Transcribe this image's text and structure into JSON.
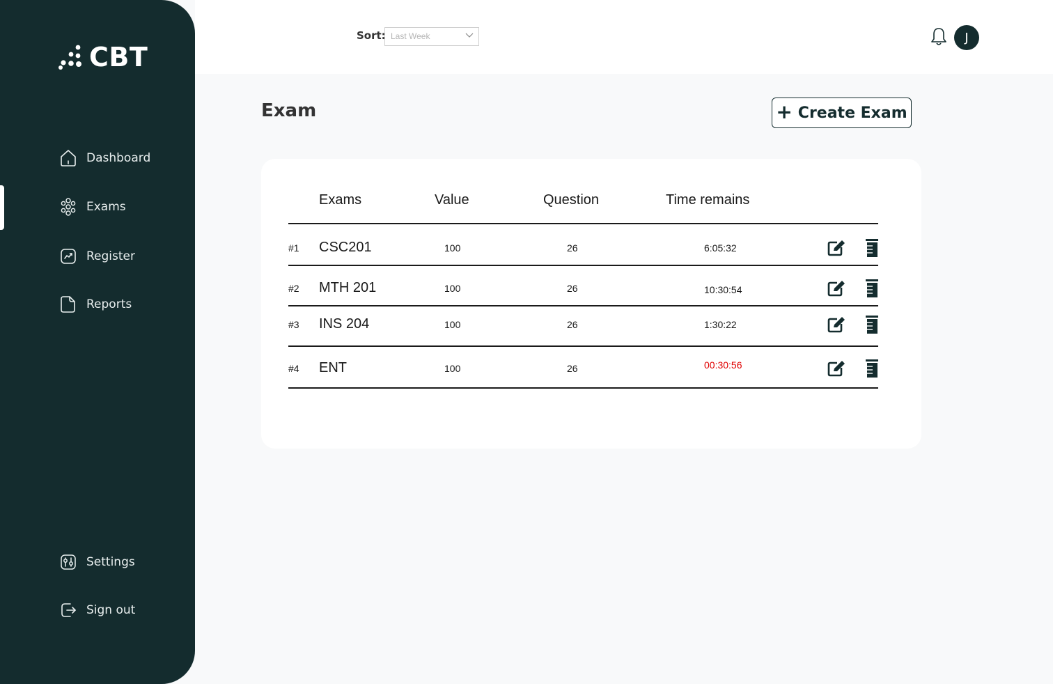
{
  "brand": {
    "name": "CBT",
    "icon": "dots-logo-icon"
  },
  "sidebar": {
    "items": [
      {
        "label": "Dashboard",
        "icon": "home-icon"
      },
      {
        "label": "Exams",
        "icon": "people-icon",
        "active": true
      },
      {
        "label": "Register",
        "icon": "chart-icon"
      },
      {
        "label": "Reports",
        "icon": "document-icon"
      }
    ],
    "bottom_items": [
      {
        "label": "Settings",
        "icon": "settings-icon"
      },
      {
        "label": "Sign out",
        "icon": "sign-out-icon"
      }
    ]
  },
  "topbar": {
    "sort_label": "Sort:",
    "sort_value": "Last Week",
    "avatar_initial": "J",
    "bell_icon": "bell-icon"
  },
  "main": {
    "title": "Exam",
    "create_button": {
      "icon": "+",
      "label": "Create Exam"
    }
  },
  "table": {
    "headers": {
      "exams": "Exams",
      "value": "Value",
      "question": "Question",
      "time": "Time remains"
    },
    "rows": [
      {
        "num": "#1",
        "name": "CSC201",
        "value": "100",
        "questions": "26",
        "time": "6:05:32",
        "urgent": false
      },
      {
        "num": "#2",
        "name": "MTH 201",
        "value": "100",
        "questions": "26",
        "time": "10:30:54",
        "urgent": false
      },
      {
        "num": "#3",
        "name": "INS 204",
        "value": "100",
        "questions": "26",
        "time": "1:30:22",
        "urgent": false
      },
      {
        "num": "#4",
        "name": "ENT",
        "value": "100",
        "questions": "26",
        "time": "00:30:56",
        "urgent": true
      }
    ]
  },
  "colors": {
    "sidebar": "#142c2e",
    "background": "#f8f9fa",
    "urgent": "#e00000"
  }
}
